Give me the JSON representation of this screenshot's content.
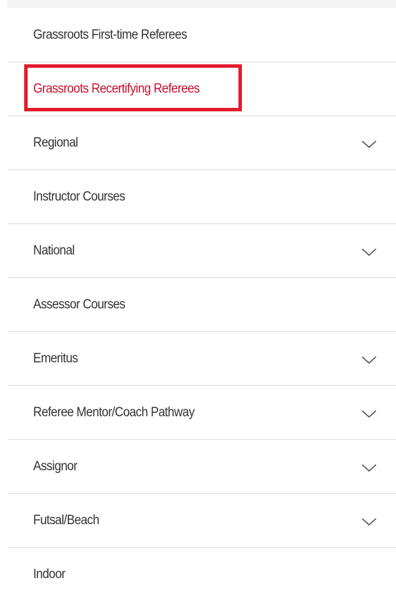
{
  "menu": {
    "items": [
      {
        "label": "Grassroots First-time Referees",
        "expandable": false,
        "active": false
      },
      {
        "label": "Grassroots Recertifying Referees",
        "expandable": false,
        "active": true,
        "highlighted": true
      },
      {
        "label": "Regional",
        "expandable": true,
        "active": false
      },
      {
        "label": "Instructor Courses",
        "expandable": false,
        "active": false
      },
      {
        "label": "National",
        "expandable": true,
        "active": false
      },
      {
        "label": "Assessor Courses",
        "expandable": false,
        "active": false
      },
      {
        "label": "Emeritus",
        "expandable": true,
        "active": false
      },
      {
        "label": "Referee Mentor/Coach Pathway",
        "expandable": true,
        "active": false
      },
      {
        "label": "Assignor",
        "expandable": true,
        "active": false
      },
      {
        "label": "Futsal/Beach",
        "expandable": true,
        "active": false
      },
      {
        "label": "Indoor",
        "expandable": false,
        "active": false
      }
    ]
  },
  "colors": {
    "text": "#333333",
    "active_text": "#c8102e",
    "highlight_border": "#e31b2b",
    "divider": "#dcdcdc",
    "chevron": "#555555"
  },
  "icons": {
    "expand": "chevron-down-icon"
  }
}
